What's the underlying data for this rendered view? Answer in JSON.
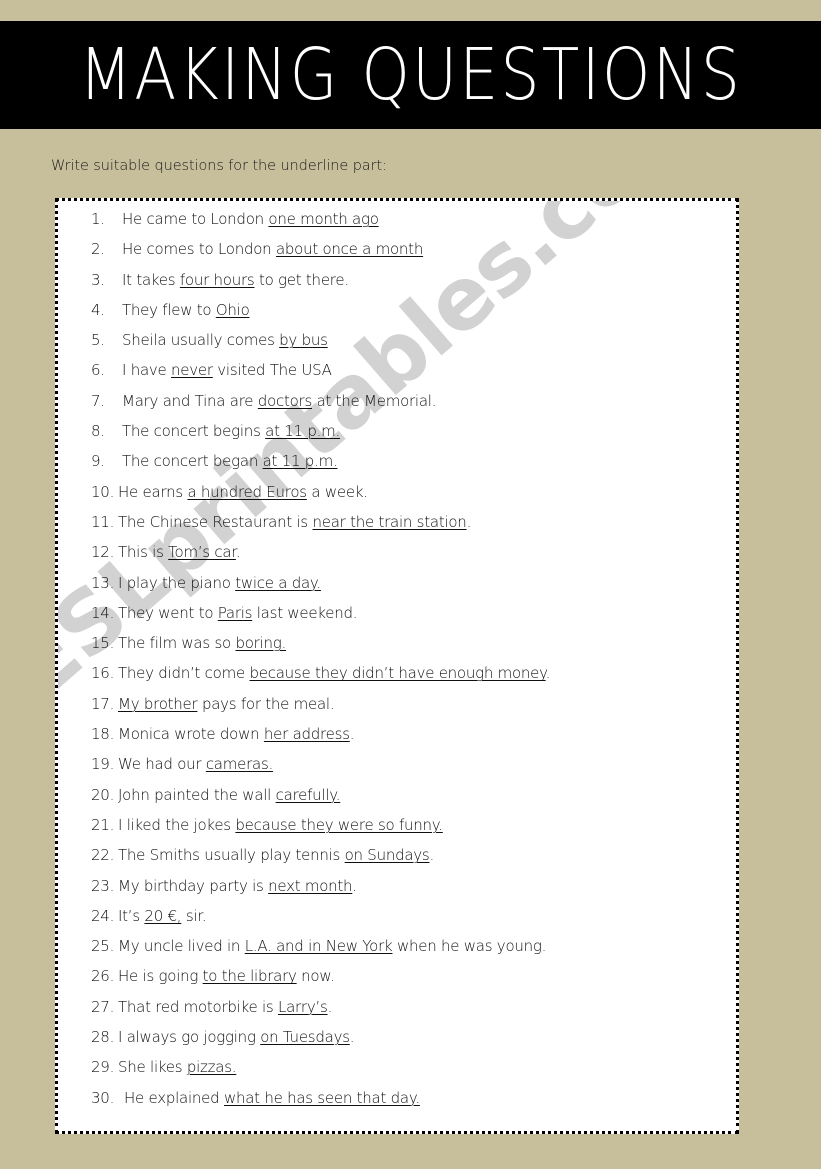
{
  "page": {
    "background_color": "#c7be9b",
    "banner_color": "#000000",
    "title": "MAKING QUESTIONS",
    "instruction": "Write suitable questions for the underline part:",
    "watermark": "ESLprintables.com",
    "watermark_color": "#d2d2d2",
    "box_background": "#ffffff",
    "box_border_color": "#000000"
  },
  "questions": [
    {
      "num": "1.",
      "pre": "He came to London ",
      "underline": "one month ago",
      "post": ""
    },
    {
      "num": "2.",
      "pre": "He comes to London ",
      "underline": "about once a month",
      "post": ""
    },
    {
      "num": "3.",
      "pre": "It takes ",
      "underline": "four hours",
      "post": " to get there."
    },
    {
      "num": "4.",
      "pre": "They flew to ",
      "underline": "Ohio",
      "post": ""
    },
    {
      "num": "5.",
      "pre": "Sheila usually comes ",
      "underline": "by bus",
      "post": ""
    },
    {
      "num": "6.",
      "pre": "I have ",
      "underline": "never",
      "post": " visited The USA"
    },
    {
      "num": "7.",
      "pre": "Mary and Tina are ",
      "underline": "doctors",
      "post": " at the Memorial."
    },
    {
      "num": "8.",
      "pre": "The concert begins ",
      "underline": "at 11 p.m.",
      "post": ""
    },
    {
      "num": "9.",
      "pre": "The concert began ",
      "underline": "at 11 p.m.",
      "post": ""
    },
    {
      "num": "10.",
      "pre": "He earns ",
      "underline": "a hundred Euros",
      "post": " a week."
    },
    {
      "num": "11.",
      "pre": "The Chinese Restaurant is ",
      "underline": "near the train station",
      "post": "."
    },
    {
      "num": "12.",
      "pre": "This is ",
      "underline": "Tom’s car",
      "post": "."
    },
    {
      "num": "13.",
      "pre": "I play the piano ",
      "underline": "twice a day.",
      "post": ""
    },
    {
      "num": "14.",
      "pre": "They went to ",
      "underline": "Paris",
      "post": " last weekend."
    },
    {
      "num": "15.",
      "pre": "The film was so ",
      "underline": "boring.",
      "post": ""
    },
    {
      "num": "16.",
      "pre": "They didn’t come ",
      "underline": "because they didn’t have enough money",
      "post": "."
    },
    {
      "num": "17.",
      "pre": "",
      "underline": "My brother",
      "post": " pays for the meal."
    },
    {
      "num": "18.",
      "pre": "Monica wrote down ",
      "underline": "her address",
      "post": "."
    },
    {
      "num": "19.",
      "pre": "We had our ",
      "underline": "cameras.",
      "post": ""
    },
    {
      "num": "20.",
      "pre": "John painted the wall ",
      "underline": "carefully.",
      "post": ""
    },
    {
      "num": "21.",
      "pre": "I liked the jokes ",
      "underline": "because they were so funny.",
      "post": ""
    },
    {
      "num": "22.",
      "pre": "The Smiths usually play tennis ",
      "underline": "on Sundays",
      "post": "."
    },
    {
      "num": "23.",
      "pre": "My birthday party is ",
      "underline": "next month",
      "post": "."
    },
    {
      "num": "24.",
      "pre": "It’s ",
      "underline": "20 €,",
      "post": " sir."
    },
    {
      "num": "25.",
      "pre": "My uncle lived in ",
      "underline": "L.A. and in New York",
      "post": " when he was young."
    },
    {
      "num": "26.",
      "pre": "He is going ",
      "underline": "to the library",
      "post": " now."
    },
    {
      "num": "27.",
      "pre": "That red motorbike is ",
      "underline": "Larry’s",
      "post": "."
    },
    {
      "num": "28.",
      "pre": "I always go jogging ",
      "underline": "on Tuesdays",
      "post": "."
    },
    {
      "num": "29.",
      "pre": "She likes ",
      "underline": "pizzas.",
      "post": ""
    },
    {
      "num": "30.",
      "pre": "He explained ",
      "underline": "what he has seen that day.",
      "post": ""
    }
  ]
}
